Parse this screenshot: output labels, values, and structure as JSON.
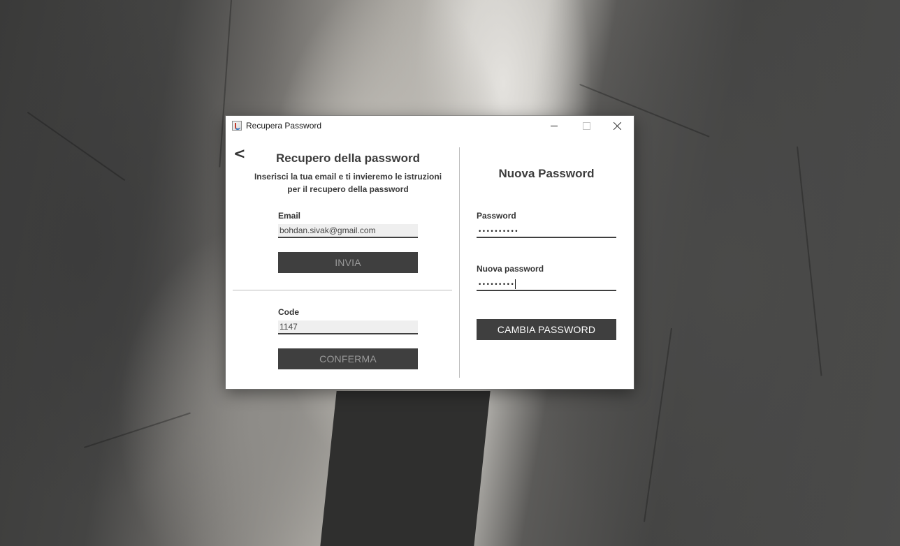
{
  "window": {
    "title": "Recupera Password"
  },
  "left": {
    "back_label": "<",
    "title": "Recupero della password",
    "subtitle_line1": "Inserisci la tua email e ti invieremo le istruzioni",
    "subtitle_line2": "per il recupero della password",
    "email_label": "Email",
    "email_value": "bohdan.sivak@gmail.com",
    "send_button": "INVIA",
    "code_label": "Code",
    "code_value": "1147",
    "confirm_button": "CONFERMA"
  },
  "right": {
    "title": "Nuova Password",
    "password_label": "Password",
    "password_value": "••••••••••",
    "new_password_label": "Nuova password",
    "new_password_value": "•••••••••",
    "change_button": "CAMBIA PASSWORD"
  },
  "colors": {
    "button_bg": "#3f3f3f",
    "disabled_text": "#9a9a9a",
    "enabled_text": "#ffffff",
    "field_bg": "#efefef"
  },
  "icons": {
    "app": "java-cup-icon",
    "minimize": "minimize-icon",
    "maximize": "maximize-icon",
    "close": "close-icon"
  }
}
